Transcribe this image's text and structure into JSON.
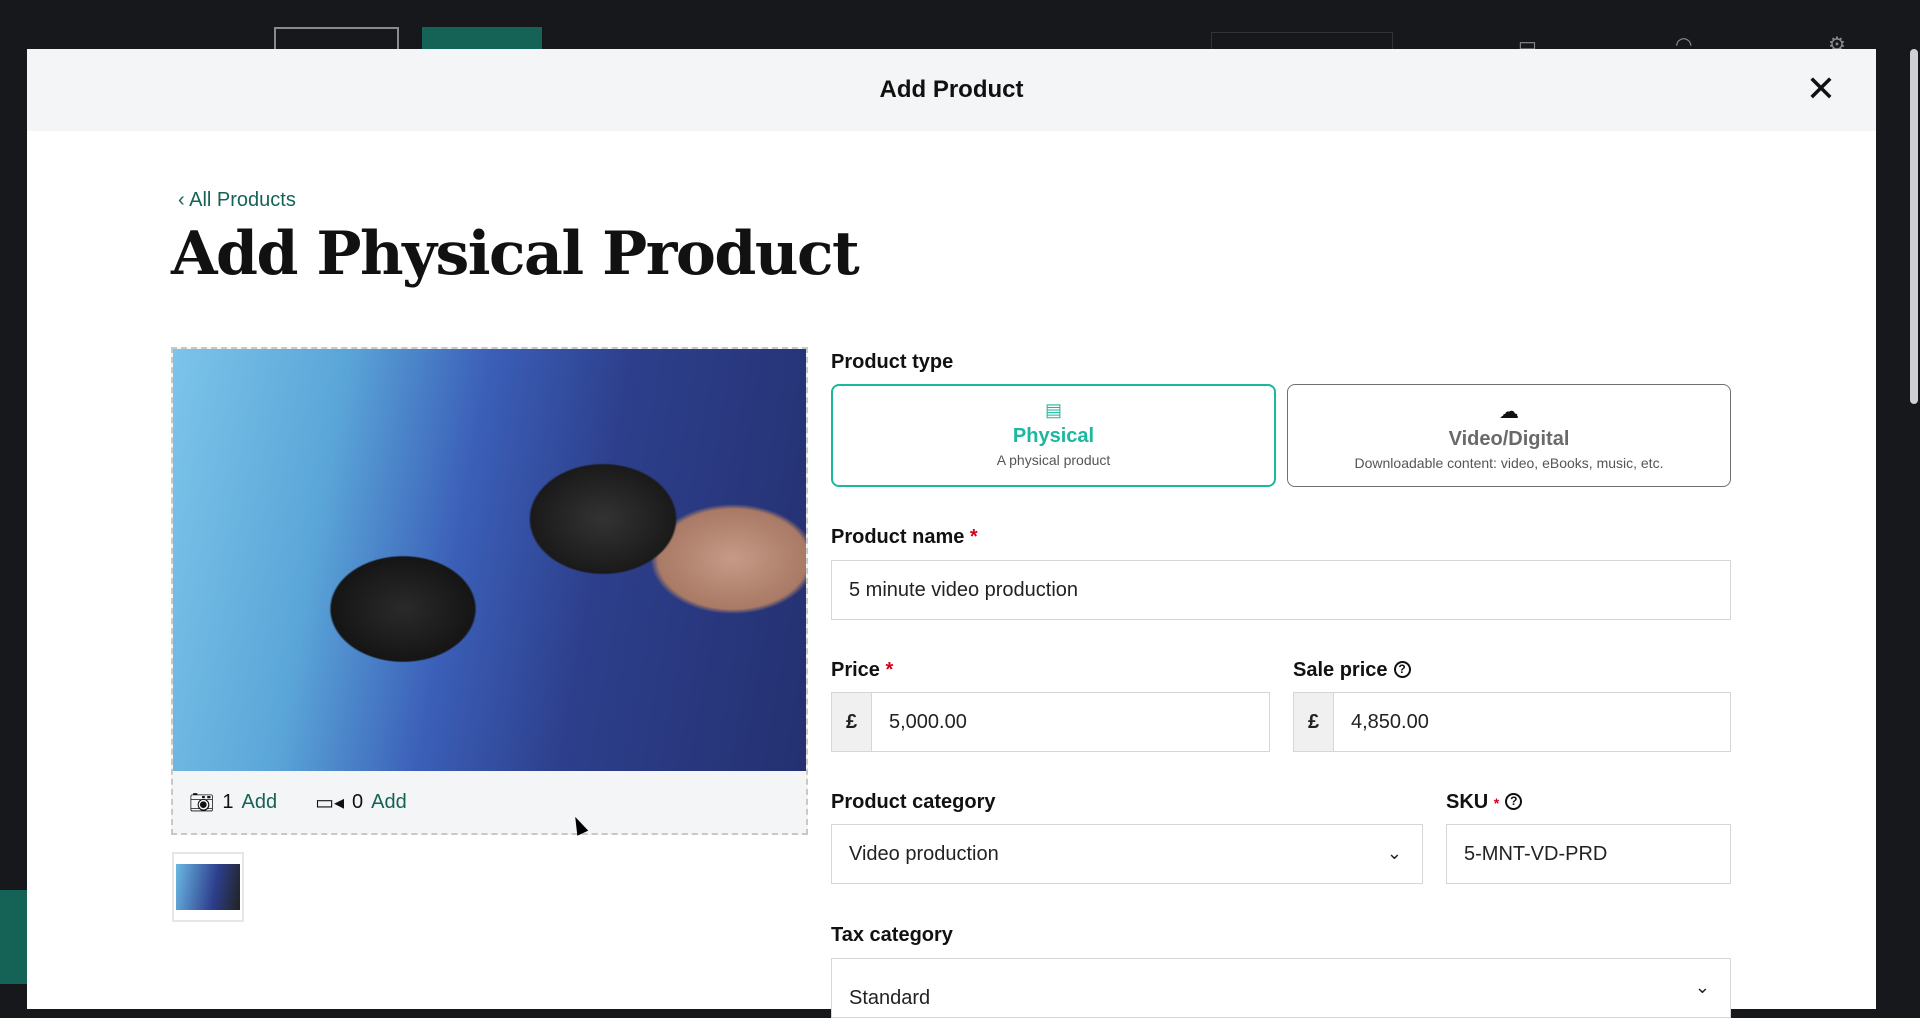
{
  "modal": {
    "title": "Add Product",
    "close_icon": "close-icon"
  },
  "back_link": "‹ All Products",
  "page_title": "Add Physical Product",
  "media": {
    "photo_count": "1",
    "photo_add": "Add",
    "video_count": "0",
    "video_add": "Add"
  },
  "form": {
    "product_type_label": "Product type",
    "types": [
      {
        "title": "Physical",
        "subtitle": "A physical product",
        "icon": "store-icon",
        "selected": true
      },
      {
        "title": "Video/Digital",
        "subtitle": "Downloadable content: video, eBooks, music, etc.",
        "icon": "cloud-download-icon",
        "selected": false
      }
    ],
    "product_name_label": "Product name",
    "product_name": "5 minute video production",
    "price_label": "Price",
    "currency": "£",
    "price": "5,000.00",
    "sale_price_label": "Sale price",
    "sale_price": "4,850.00",
    "category_label": "Product category",
    "category": "Video production",
    "sku_label": "SKU",
    "sku": "5-MNT-VD-PRD",
    "tax_label": "Tax category",
    "tax": "Standard",
    "required_mark": "*",
    "help_mark": "?"
  },
  "colors": {
    "accent": "#1bb89e",
    "brand": "#146356",
    "required": "#d0021b"
  }
}
